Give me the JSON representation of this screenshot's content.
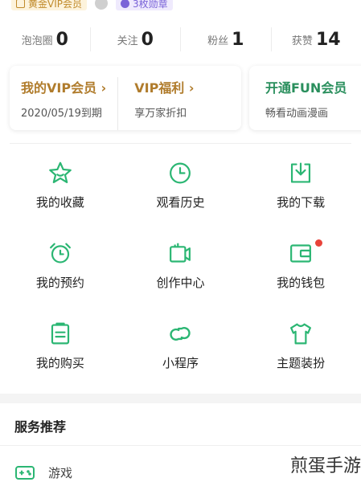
{
  "badges": {
    "vip_label": "黄金VIP会员",
    "medal_label": "3枚勋章"
  },
  "stats": [
    {
      "label": "泡泡圈",
      "value": "0"
    },
    {
      "label": "关注",
      "value": "0"
    },
    {
      "label": "粉丝",
      "value": "1"
    },
    {
      "label": "获赞",
      "value": "14"
    }
  ],
  "vip": {
    "my_vip": {
      "title": "我的VIP会员 ›",
      "sub": "2020/05/19到期"
    },
    "vip_welfare": {
      "title": "VIP福利 ›",
      "sub": "享万家折扣"
    },
    "fun_vip": {
      "title": "开通FUN会员",
      "sub": "畅看动画漫画"
    }
  },
  "grid": [
    {
      "label": "我的收藏",
      "icon": "star-icon"
    },
    {
      "label": "观看历史",
      "icon": "clock-icon"
    },
    {
      "label": "我的下载",
      "icon": "download-icon"
    },
    {
      "label": "我的预约",
      "icon": "alarm-icon"
    },
    {
      "label": "创作中心",
      "icon": "camera-icon"
    },
    {
      "label": "我的钱包",
      "icon": "wallet-icon"
    },
    {
      "label": "我的购买",
      "icon": "clipboard-icon"
    },
    {
      "label": "小程序",
      "icon": "link-icon"
    },
    {
      "label": "主题装扮",
      "icon": "tshirt-icon"
    }
  ],
  "services": {
    "title": "服务推荐",
    "items": [
      {
        "label": "游戏",
        "icon": "gamepad-icon"
      }
    ]
  },
  "watermark": "煎蛋手游",
  "colors": {
    "accent_green": "#2bb673",
    "gold": "#b07c2c",
    "notification_red": "#e8433a"
  }
}
